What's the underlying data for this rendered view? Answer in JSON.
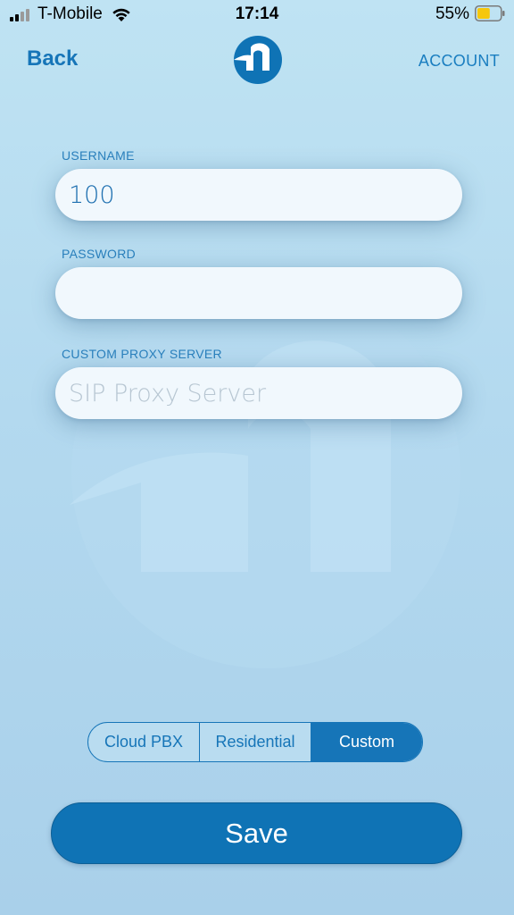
{
  "status_bar": {
    "carrier": "T-Mobile",
    "time": "17:14",
    "battery_percent": "55%",
    "signal_bars": 2,
    "battery_level": 0.55
  },
  "nav": {
    "back_label": "Back",
    "account_label": "ACCOUNT",
    "logo_icon": "n-logo-icon"
  },
  "form": {
    "username": {
      "label": "USERNAME",
      "value": "100",
      "placeholder": ""
    },
    "password": {
      "label": "PASSWORD",
      "value": "",
      "placeholder": ""
    },
    "proxy": {
      "label": "CUSTOM PROXY SERVER",
      "value": "",
      "placeholder": "SIP Proxy Server"
    }
  },
  "segments": {
    "options": [
      "Cloud PBX",
      "Residential",
      "Custom"
    ],
    "selected": "Custom"
  },
  "actions": {
    "save_label": "Save"
  },
  "colors": {
    "accent": "#1675b8",
    "background": "#b3d9ef",
    "input_bg": "#f1f8fd"
  }
}
